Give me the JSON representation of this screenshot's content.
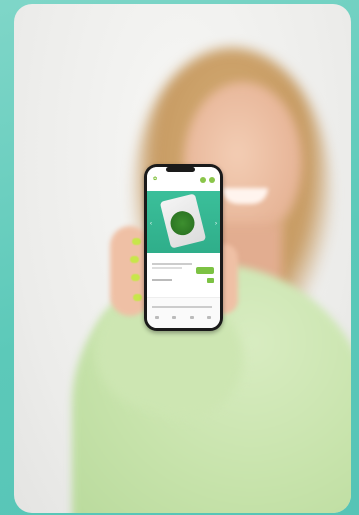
{
  "scene": {
    "background_color": "#5cc9b9",
    "card_color": "#ececea",
    "sweater_color": "#c7e3ab",
    "nail_color": "#c8e64a"
  },
  "phone_app": {
    "hero_color": "#2fae8a",
    "accent_color": "#7cc243",
    "icons": [
      "cart-icon",
      "menu-icon",
      "chevron-left-icon",
      "chevron-right-icon"
    ]
  }
}
